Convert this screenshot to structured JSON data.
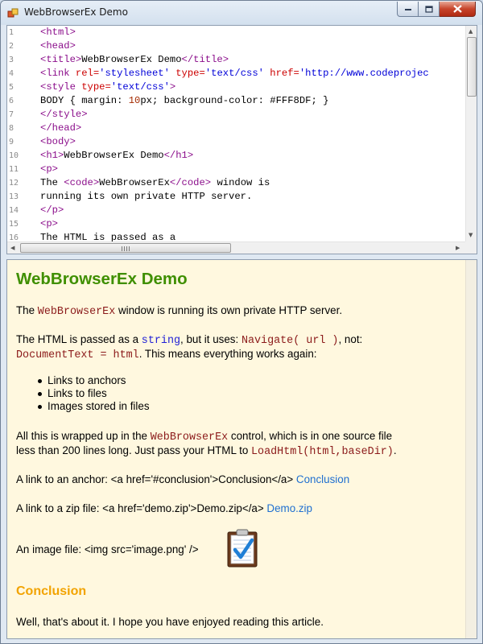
{
  "window": {
    "title": "WebBrowserEx Demo"
  },
  "editor": {
    "lines": [
      {
        "n": "1"
      },
      {
        "n": "2"
      },
      {
        "n": "3"
      },
      {
        "n": "4"
      },
      {
        "n": "5"
      },
      {
        "n": "6"
      },
      {
        "n": "7"
      },
      {
        "n": "8"
      },
      {
        "n": "9"
      },
      {
        "n": "10"
      },
      {
        "n": "11"
      },
      {
        "n": "12"
      },
      {
        "n": "13"
      },
      {
        "n": "14"
      },
      {
        "n": "15"
      },
      {
        "n": "16"
      }
    ],
    "code": {
      "l1": "<html>",
      "l2": "<head>",
      "l3_open": "<title>",
      "l3_text": "WebBrowserEx Demo",
      "l3_close": "</title>",
      "l4_open": "<link",
      "l4_a1": " rel=",
      "l4_v1": "'stylesheet'",
      "l4_a2": " type=",
      "l4_v2": "'text/css'",
      "l4_a3": " href=",
      "l4_v3": "'http://www.codeprojec",
      "l5_open": "<style",
      "l5_a1": " type=",
      "l5_v1": "'text/css'",
      "l5_close": ">",
      "l6_a": "BODY { margin: ",
      "l6_n": "10",
      "l6_b": "px; background-color: #FFF8DF; }",
      "l7": "</style>",
      "l8": "</head>",
      "l9": "<body>",
      "l10_open": "<h1>",
      "l10_text": "WebBrowserEx Demo",
      "l10_close": "</h1>",
      "l11": "<p>",
      "l12_a": "The ",
      "l12_open": "<code>",
      "l12_text": "WebBrowserEx",
      "l12_close": "</code>",
      "l12_b": " window is",
      "l13": "running its own private HTTP server.",
      "l14": "</p>",
      "l15": "<p>",
      "l16": "The HTML is passed as a"
    }
  },
  "browser": {
    "title": "WebBrowserEx Demo",
    "p1_a": "The ",
    "p1_code": "WebBrowserEx",
    "p1_b": " window is running its own private HTTP server.",
    "p2_a": "The HTML is passed as a ",
    "p2_code1": "string",
    "p2_b": ", but it uses: ",
    "p2_code2": "Navigate( url )",
    "p2_c": ", not:",
    "p2_code3": "DocumentText = html",
    "p2_d": ". This means everything works again:",
    "list": [
      "Links to anchors",
      "Links to files",
      "Images stored in files"
    ],
    "p3_a": "All this is wrapped up in the ",
    "p3_code": "WebBrowserEx",
    "p3_b": " control, which is in one source file",
    "p3_c": "less than 200 lines long. Just pass your HTML to ",
    "p3_code2": "LoadHtml(html,baseDir)",
    "p3_d": ".",
    "anchor_label": "A link to an anchor: <a href='#conclusion'>Conclusion</a> ",
    "anchor_link": "Conclusion",
    "zip_label": "A link to a zip file: <a href='demo.zip'>Demo.zip</a> ",
    "zip_link": "Demo.zip",
    "image_label": "An image file: <img src='image.png' />",
    "conclusion_heading": "Conclusion",
    "conclusion_text": "Well, that's about it. I hope you have enjoyed reading this article."
  },
  "icons": {
    "app": "app-window-icon",
    "minimize": "minimize-icon",
    "maximize": "maximize-icon",
    "close": "close-icon",
    "clipboard": "clipboard-check-icon"
  },
  "colors": {
    "page_background": "#FFF8DF",
    "heading": "#3F8F00",
    "conclusion": "#F2A300",
    "link": "#1F6FD0"
  }
}
